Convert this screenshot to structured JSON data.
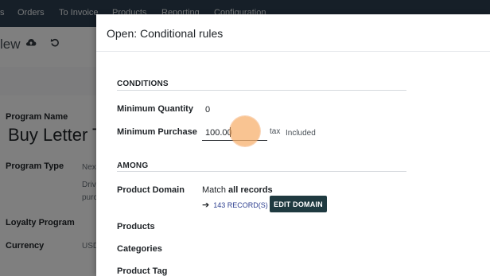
{
  "background": {
    "nav_items": [
      "s",
      "Orders",
      "To Invoice",
      "Products",
      "Reporting",
      "Configuration"
    ],
    "view_label": "lew",
    "fields": [
      {
        "label": "Program Name",
        "value": ""
      },
      {
        "label": "Program Type",
        "value": "Nex"
      },
      {
        "label": "Loyalty Program",
        "value": ""
      },
      {
        "label": "Currency",
        "value": "USD"
      }
    ],
    "program_title": "Buy Letter T",
    "program_type_desc_1": "Drive",
    "program_type_desc_2": "purc"
  },
  "dialog": {
    "title": "Open: Conditional rules",
    "conditions": {
      "heading": "CONDITIONS",
      "min_qty_label": "Minimum Quantity",
      "min_qty_value": "0",
      "min_purchase_label": "Minimum Purchase",
      "min_purchase_value": "100.00",
      "tax_label": "tax",
      "tax_value": "Included"
    },
    "among": {
      "heading": "AMONG",
      "product_domain_label": "Product Domain",
      "match_prefix": "Match",
      "match_value": "all records",
      "records_link": "143 RECORD(S)",
      "edit_domain_button": "EDIT DOMAIN",
      "products_label": "Products",
      "categories_label": "Categories",
      "product_tag_label": "Product Tag"
    }
  },
  "colors": {
    "topnav_bg": "#2c3e50",
    "button_bg": "#1f3a40",
    "link": "#2c3e8f",
    "click_marker": "#f7b06e"
  }
}
